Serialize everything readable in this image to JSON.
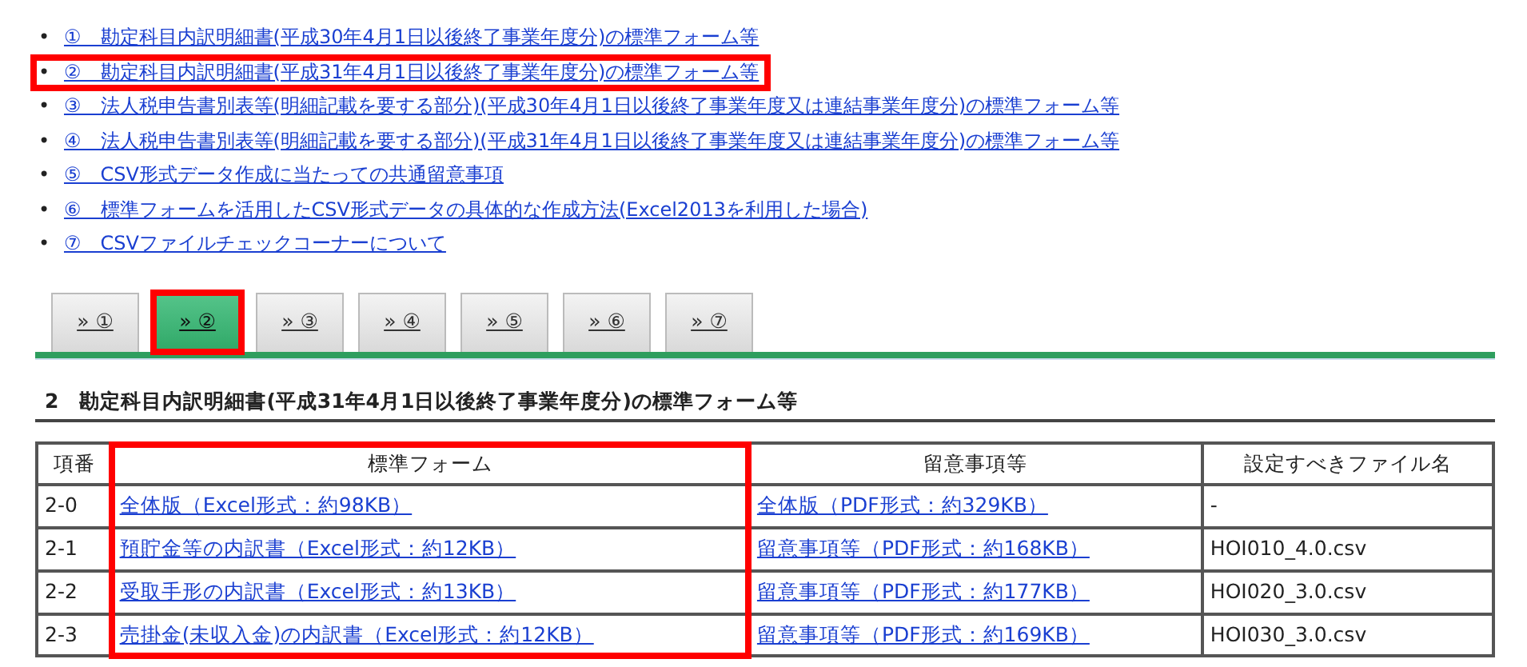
{
  "bullet": "•",
  "links": [
    {
      "label": "①　勘定科目内訳明細書(平成30年4月1日以後終了事業年度分)の標準フォーム等",
      "highlighted": false
    },
    {
      "label": "②　勘定科目内訳明細書(平成31年4月1日以後終了事業年度分)の標準フォーム等",
      "highlighted": true
    },
    {
      "label": "③　法人税申告書別表等(明細記載を要する部分)(平成30年4月1日以後終了事業年度又は連結事業年度分)の標準フォーム等",
      "highlighted": false
    },
    {
      "label": "④　法人税申告書別表等(明細記載を要する部分)(平成31年4月1日以後終了事業年度又は連結事業年度分)の標準フォーム等",
      "highlighted": false
    },
    {
      "label": "⑤　CSV形式データ作成に当たっての共通留意事項",
      "highlighted": false
    },
    {
      "label": "⑥　標準フォームを活用したCSV形式データの具体的な作成方法(Excel2013を利用した場合)",
      "highlighted": false
    },
    {
      "label": "⑦　CSVファイルチェックコーナーについて",
      "highlighted": false
    }
  ],
  "tabs": [
    {
      "label": "» ①",
      "selected": false,
      "highlighted": false
    },
    {
      "label": "» ②",
      "selected": true,
      "highlighted": true
    },
    {
      "label": "» ③",
      "selected": false,
      "highlighted": false
    },
    {
      "label": "» ④",
      "selected": false,
      "highlighted": false
    },
    {
      "label": "» ⑤",
      "selected": false,
      "highlighted": false
    },
    {
      "label": "» ⑥",
      "selected": false,
      "highlighted": false
    },
    {
      "label": "» ⑦",
      "selected": false,
      "highlighted": false
    }
  ],
  "section_heading": "2　勘定科目内訳明細書(平成31年4月1日以後終了事業年度分)の標準フォーム等",
  "table": {
    "columns": [
      {
        "label": "項番",
        "highlighted": false
      },
      {
        "label": "標準フォーム",
        "highlighted": true
      },
      {
        "label": "留意事項等",
        "highlighted": false
      },
      {
        "label": "設定すべきファイル名",
        "highlighted": false
      }
    ],
    "rows": [
      [
        {
          "kind": "text",
          "text": "2-0"
        },
        {
          "kind": "link",
          "text": "全体版（Excel形式：約98KB）"
        },
        {
          "kind": "link",
          "text": "全体版（PDF形式：約329KB）"
        },
        {
          "kind": "text",
          "text": "-"
        }
      ],
      [
        {
          "kind": "text",
          "text": "2-1"
        },
        {
          "kind": "link",
          "text": "預貯金等の内訳書（Excel形式：約12KB）"
        },
        {
          "kind": "link",
          "text": "留意事項等（PDF形式：約168KB）"
        },
        {
          "kind": "text",
          "text": "HOI010_4.0.csv"
        }
      ],
      [
        {
          "kind": "text",
          "text": "2-2"
        },
        {
          "kind": "link",
          "text": "受取手形の内訳書（Excel形式：約13KB）"
        },
        {
          "kind": "link",
          "text": "留意事項等（PDF形式：約177KB）"
        },
        {
          "kind": "text",
          "text": "HOI020_3.0.csv"
        }
      ],
      [
        {
          "kind": "text",
          "text": "2-3"
        },
        {
          "kind": "link",
          "text": "売掛金(未収入金)の内訳書（Excel形式：約12KB）"
        },
        {
          "kind": "link",
          "text": "留意事項等（PDF形式：約169KB）"
        },
        {
          "kind": "text",
          "text": "HOI030_3.0.csv"
        }
      ]
    ]
  }
}
